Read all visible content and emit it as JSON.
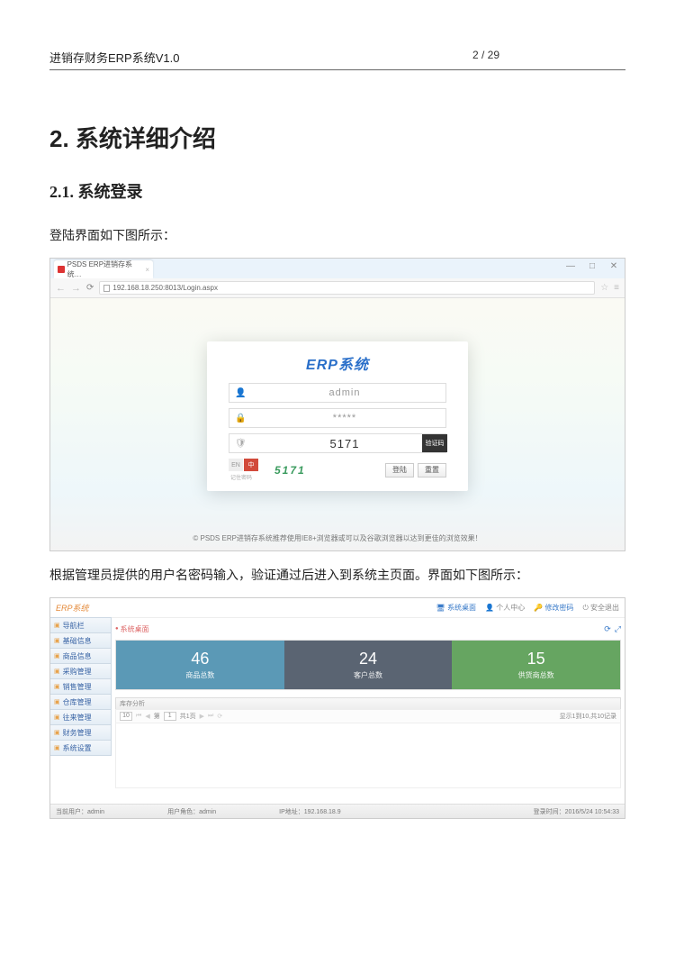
{
  "doc": {
    "header_title": "进销存财务ERP系统V1.0",
    "page_indicator": "2 / 29",
    "h1": "2. 系统详细介绍",
    "h2": "2.1. 系统登录",
    "intro": "登陆界面如下图所示：",
    "after_login": "根据管理员提供的用户名密码输入，验证通过后进入到系统主页面。界面如下图所示："
  },
  "login": {
    "tab_title": "PSDS ERP进销存系统…",
    "url": "192.168.18.250:8013/Login.aspx",
    "app_title": "ERP系统",
    "username": "admin",
    "password": "*****",
    "verify_input": "5171",
    "verify_label": "验证码",
    "captcha_display": "5171",
    "lang_en": "EN",
    "lang_cn": "中",
    "remember_label": "记住密码",
    "btn_login": "登陆",
    "btn_reset": "重置",
    "footer": "© PSDS ERP进销存系统推荐使用IE8+浏览器或可以及谷歌浏览器以达到更佳的浏览效果！"
  },
  "dash": {
    "brand": "ERP系统",
    "topmenu": {
      "desktop": "系统桌面",
      "personal": "个人中心",
      "change": "修改密码",
      "logout": "安全退出"
    },
    "sidebar": [
      "导航栏",
      "基础信息",
      "商品信息",
      "采购管理",
      "销售管理",
      "仓库管理",
      "往来管理",
      "财务管理",
      "系统设置"
    ],
    "main_tab": "系统桌面",
    "tiles": [
      {
        "num": "46",
        "label": "商品总数"
      },
      {
        "num": "24",
        "label": "客户总数"
      },
      {
        "num": "15",
        "label": "供货商总数"
      }
    ],
    "panel_title": "库存分析",
    "pager": {
      "size": "10",
      "prefix": "第",
      "page": "1",
      "suffix": "共1页",
      "info": "显示1到10,共10记录"
    },
    "footer": {
      "user_label": "当前用户：",
      "user": "admin",
      "role_label": "用户角色：",
      "role": "admin",
      "ip_label": "IP地址：",
      "ip": "192.168.18.9",
      "time_label": "登录时间：",
      "time": "2016/5/24 10:54:33"
    }
  }
}
